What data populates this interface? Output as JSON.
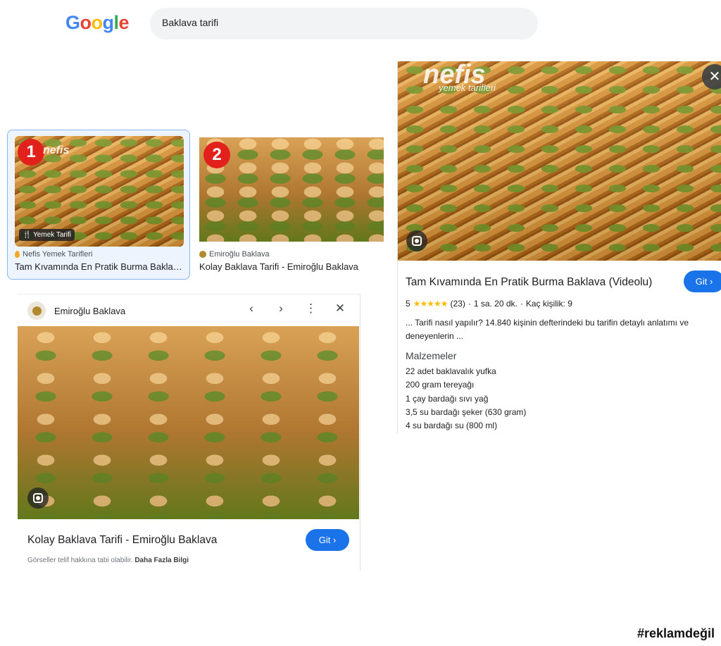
{
  "header": {
    "logo_letters": [
      {
        "ch": "G",
        "color": "#4285F4"
      },
      {
        "ch": "o",
        "color": "#EA4335"
      },
      {
        "ch": "o",
        "color": "#FBBC05"
      },
      {
        "ch": "g",
        "color": "#4285F4"
      },
      {
        "ch": "l",
        "color": "#34A853"
      },
      {
        "ch": "e",
        "color": "#EA4335"
      }
    ],
    "query": "Baklava tarifi"
  },
  "results": [
    {
      "badge": "1",
      "watermark": "nefis",
      "chip": "🍴 Yemek Tarifi",
      "source": "Nefis Yemek Tarifleri",
      "title": "Tam Kıvamında En Pratik Burma Baklava (Videolu)"
    },
    {
      "badge": "2",
      "source": "Emiroğlu Baklava",
      "title": "Kolay Baklava Tarifi - Emiroğlu Baklava"
    }
  ],
  "right_panel": {
    "watermark_main": "nefis",
    "watermark_sub": "yemek tarifleri",
    "close_icon": "✕",
    "title": "Tam Kıvamında En Pratik Burma Baklava (Videolu)",
    "go_label": "Git ›",
    "rating": "5",
    "stars": "★★★★★",
    "reviews": "(23)",
    "sep": "·",
    "duration": "1 sa. 20 dk.",
    "servings": "Kaç kişilik: 9",
    "description": "... Tarifi nasıl yapılır? 14.840 kişinin defterindeki bu tarifin detaylı anlatımı ve deneyenlerin ...",
    "ingredients_heading": "Malzemeler",
    "ingredients": [
      "22 adet baklavalık yufka",
      "200 gram tereyağı",
      "1 çay bardağı sıvı yağ",
      "3,5 su bardağı şeker (630 gram)",
      "4 su bardağı su (800 ml)"
    ]
  },
  "left_panel": {
    "site_name": "Emiroğlu Baklava",
    "nav_prev": "‹",
    "nav_next": "›",
    "nav_more": "⋮",
    "nav_close": "✕",
    "title": "Kolay Baklava Tarifi - Emiroğlu Baklava",
    "go_label": "Git ›",
    "footer_text": "Görseller telif hakkına tabi olabilir.",
    "footer_link": "Daha Fazla Bilgi"
  },
  "hashtag": "#reklamdeğil"
}
